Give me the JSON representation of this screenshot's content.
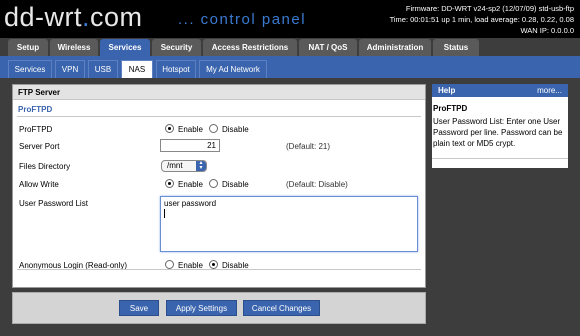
{
  "header": {
    "logo_main": "dd-wrt",
    "logo_dot": ".",
    "logo_com": "com",
    "subtitle": "... control panel",
    "firmware": "Firmware: DD-WRT v24-sp2 (12/07/09) std-usb-ftp",
    "time": "Time: 00:01:51 up 1 min, load average: 0.28, 0.22, 0.08",
    "wan_ip": "WAN IP: 0.0.0.0"
  },
  "main_tabs": [
    "Setup",
    "Wireless",
    "Services",
    "Security",
    "Access Restrictions",
    "NAT / QoS",
    "Administration",
    "Status"
  ],
  "sub_tabs": [
    "Services",
    "VPN",
    "USB",
    "NAS",
    "Hotspot",
    "My Ad Network"
  ],
  "section": {
    "title": "FTP Server",
    "legend": "ProFTPD"
  },
  "form": {
    "proftpd_label": "ProFTPD",
    "proftpd_enable": "Enable",
    "proftpd_disable": "Disable",
    "port_label": "Server Port",
    "port_value": "21",
    "port_default": "(Default: 21)",
    "files_label": "Files Directory",
    "files_value": "/mnt",
    "allow_write_label": "Allow Write",
    "allow_write_enable": "Enable",
    "allow_write_disable": "Disable",
    "allow_write_default": "(Default: Disable)",
    "user_pw_label": "User Password List",
    "user_pw_value": "user password",
    "anon_label": "Anonymous Login (Read-only)",
    "anon_enable": "Enable",
    "anon_disable": "Disable"
  },
  "buttons": {
    "save": "Save",
    "apply": "Apply Settings",
    "cancel": "Cancel Changes"
  },
  "help": {
    "title": "Help",
    "more": "more...",
    "heading": "ProFTPD",
    "text": "User Password List: Enter one User Password per line. Password can be plain text or MD5 crypt."
  },
  "colors": {
    "accent": "#3a64ad",
    "header_bg": "#000000",
    "page_bg": "#3d3d3d"
  }
}
